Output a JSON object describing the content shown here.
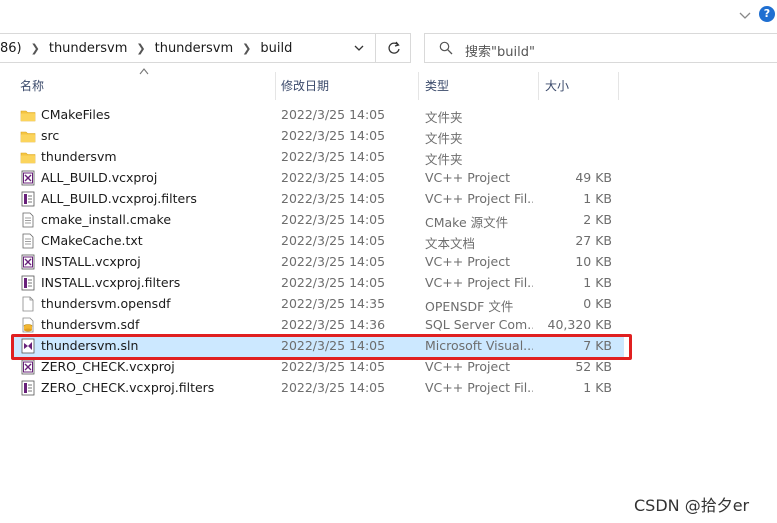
{
  "help": {
    "label": "?"
  },
  "address": {
    "crumbs": [
      "86)",
      "thundersvm",
      "thundersvm",
      "build"
    ]
  },
  "search": {
    "placeholder": "搜索\"build\""
  },
  "columns": {
    "name": "名称",
    "date": "修改日期",
    "type": "类型",
    "size": "大小"
  },
  "files": [
    {
      "name": "CMakeFiles",
      "date": "2022/3/25 14:05",
      "type": "文件夹",
      "size": "",
      "icon": "folder-icon"
    },
    {
      "name": "src",
      "date": "2022/3/25 14:05",
      "type": "文件夹",
      "size": "",
      "icon": "folder-icon"
    },
    {
      "name": "thundersvm",
      "date": "2022/3/25 14:05",
      "type": "文件夹",
      "size": "",
      "icon": "folder-icon"
    },
    {
      "name": "ALL_BUILD.vcxproj",
      "date": "2022/3/25 14:05",
      "type": "VC++ Project",
      "size": "49 KB",
      "icon": "vcxproj-icon"
    },
    {
      "name": "ALL_BUILD.vcxproj.filters",
      "date": "2022/3/25 14:05",
      "type": "VC++ Project Fil...",
      "size": "1 KB",
      "icon": "vcxproj-filters-icon"
    },
    {
      "name": "cmake_install.cmake",
      "date": "2022/3/25 14:05",
      "type": "CMake 源文件",
      "size": "2 KB",
      "icon": "text-file-icon"
    },
    {
      "name": "CMakeCache.txt",
      "date": "2022/3/25 14:05",
      "type": "文本文档",
      "size": "27 KB",
      "icon": "text-file-icon"
    },
    {
      "name": "INSTALL.vcxproj",
      "date": "2022/3/25 14:05",
      "type": "VC++ Project",
      "size": "10 KB",
      "icon": "vcxproj-icon"
    },
    {
      "name": "INSTALL.vcxproj.filters",
      "date": "2022/3/25 14:05",
      "type": "VC++ Project Fil...",
      "size": "1 KB",
      "icon": "vcxproj-filters-icon"
    },
    {
      "name": "thundersvm.opensdf",
      "date": "2022/3/25 14:35",
      "type": "OPENSDF 文件",
      "size": "0 KB",
      "icon": "blank-file-icon"
    },
    {
      "name": "thundersvm.sdf",
      "date": "2022/3/25 14:36",
      "type": "SQL Server Com...",
      "size": "40,320 KB",
      "icon": "sdf-file-icon"
    },
    {
      "name": "thundersvm.sln",
      "date": "2022/3/25 14:05",
      "type": "Microsoft Visual...",
      "size": "7 KB",
      "icon": "sln-icon",
      "selected": true
    },
    {
      "name": "ZERO_CHECK.vcxproj",
      "date": "2022/3/25 14:05",
      "type": "VC++ Project",
      "size": "52 KB",
      "icon": "vcxproj-icon"
    },
    {
      "name": "ZERO_CHECK.vcxproj.filters",
      "date": "2022/3/25 14:05",
      "type": "VC++ Project Fil...",
      "size": "1 KB",
      "icon": "vcxproj-filters-icon"
    }
  ],
  "watermark": "CSDN @拾夕er",
  "colors": {
    "selected_row": "#cce8ff",
    "highlight_border": "#e02020",
    "folder": "#f5c542",
    "help": "#1f6fd1"
  }
}
